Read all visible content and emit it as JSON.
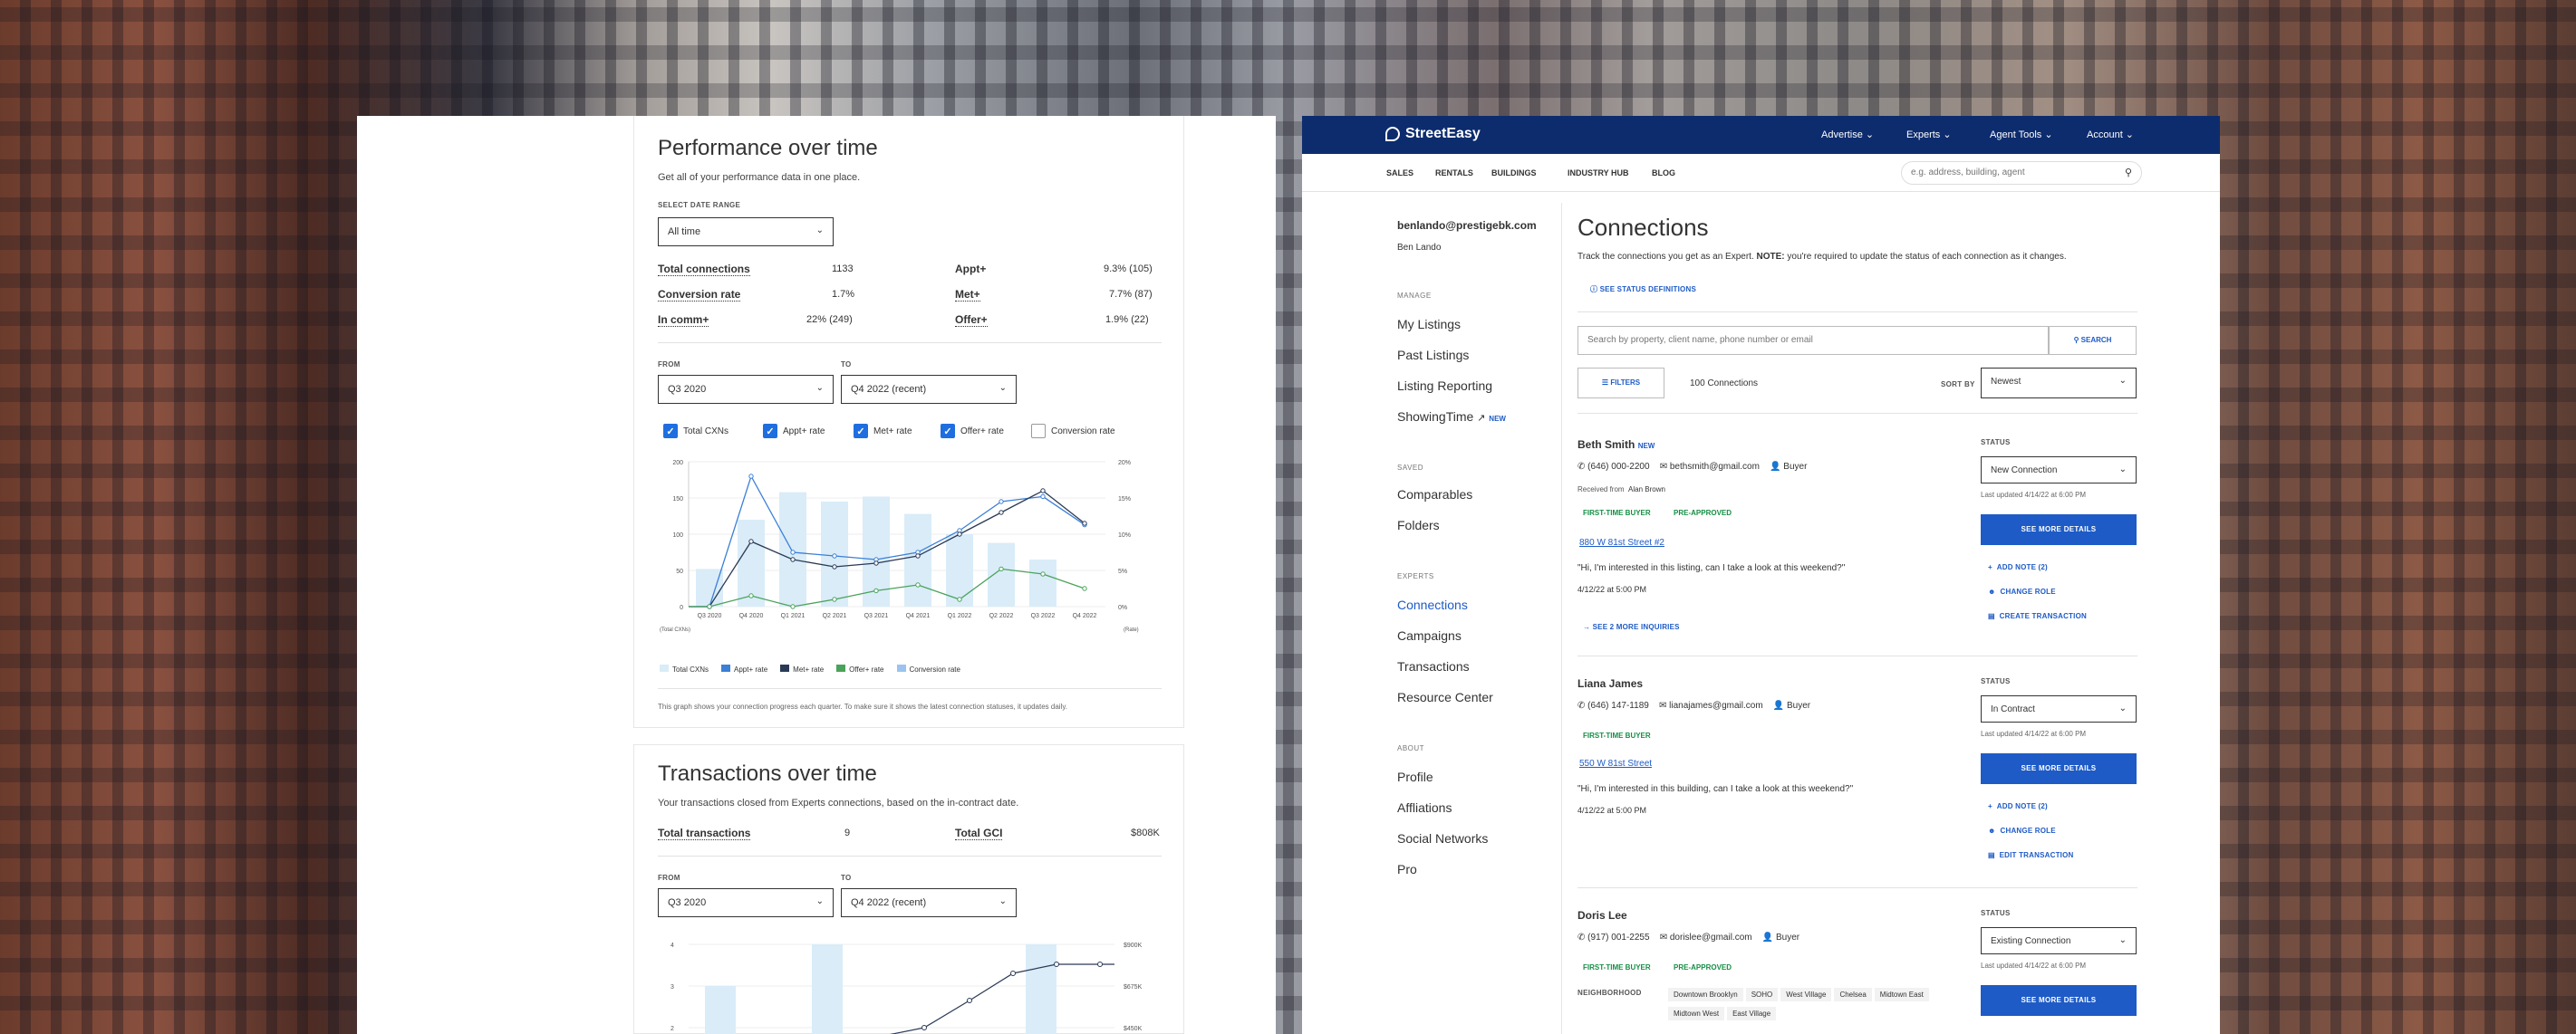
{
  "perf": {
    "title": "Performance over time",
    "subtitle": "Get all of your performance data in one place.",
    "date_range_label": "SELECT DATE RANGE",
    "date_range_value": "All time",
    "stats": [
      {
        "k": "Total connections",
        "v": "1133"
      },
      {
        "k": "Conversion rate",
        "v": "1.7%"
      },
      {
        "k": "In comm+",
        "v": "22% (249)"
      },
      {
        "k": "Appt+",
        "v": "9.3% (105)"
      },
      {
        "k": "Met+",
        "v": "7.7% (87)"
      },
      {
        "k": "Offer+",
        "v": "1.9% (22)"
      }
    ],
    "from_label": "FROM",
    "to_label": "TO",
    "from_value": "Q3 2020",
    "to_value": "Q4 2022 (recent)",
    "checks": [
      {
        "label": "Total CXNs",
        "on": true
      },
      {
        "label": "Appt+ rate",
        "on": true
      },
      {
        "label": "Met+ rate",
        "on": true
      },
      {
        "label": "Offer+ rate",
        "on": true
      },
      {
        "label": "Conversion rate",
        "on": false
      }
    ],
    "axis_left_unit": "(Total CXNs)",
    "axis_right_unit": "(Rate)",
    "footnote": "This graph shows your connection progress each quarter. To make sure it shows the latest connection statuses, it updates daily."
  },
  "trans": {
    "title": "Transactions over time",
    "subtitle": "Your transactions closed from Experts connections, based on the in-contract date.",
    "stat1_k": "Total transactions",
    "stat1_v": "9",
    "stat2_k": "Total GCI",
    "stat2_v": "$808K",
    "from_value": "Q3 2020",
    "to_value": "Q4 2022 (recent)",
    "y_ticks": [
      "4",
      "3",
      "2"
    ],
    "y2_ticks": [
      "$900K",
      "$675K",
      "$450K"
    ]
  },
  "chart_data": [
    {
      "type": "bar",
      "categories": [
        "Q3 2020",
        "Q4 2020",
        "Q1 2021",
        "Q2 2021",
        "Q3 2021",
        "Q4 2021",
        "Q1 2022",
        "Q2 2022",
        "Q3 2022",
        "Q4 2022"
      ],
      "ylim": [
        0,
        200
      ],
      "y2lim": [
        0,
        20
      ],
      "y_ticks": [
        "200",
        "150",
        "100",
        "50",
        "0"
      ],
      "y2_ticks": [
        "20%",
        "15%",
        "10%",
        "5%",
        "0%"
      ],
      "series": [
        {
          "name": "Total CXNs",
          "kind": "bar",
          "color": "#d9ecf8",
          "values": [
            52,
            120,
            158,
            145,
            152,
            128,
            100,
            88,
            65,
            0
          ]
        },
        {
          "name": "Appt+ rate",
          "kind": "line",
          "color": "#3b7fd6",
          "values": [
            0,
            18,
            7.5,
            7,
            6.5,
            7.5,
            10.5,
            14.5,
            15.2,
            11.3
          ]
        },
        {
          "name": "Met+ rate",
          "kind": "line",
          "color": "#2a3a55",
          "values": [
            0,
            9,
            6.5,
            5.5,
            6,
            7,
            10,
            13,
            16,
            11.5
          ]
        },
        {
          "name": "Offer+ rate",
          "kind": "line",
          "color": "#4aa35a",
          "values": [
            0,
            1.5,
            0,
            1,
            2.2,
            3,
            1,
            5.2,
            4.5,
            2.5
          ]
        }
      ],
      "legend": [
        "Total CXNs",
        "Appt+ rate",
        "Met+ rate",
        "Offer+ rate",
        "Conversion rate"
      ]
    }
  ],
  "se": {
    "brand": "StreetEasy",
    "nav": [
      "Advertise",
      "Experts",
      "Agent Tools",
      "Account"
    ],
    "subnav": [
      "SALES",
      "RENTALS",
      "BUILDINGS",
      "INDUSTRY HUB",
      "BLOG"
    ],
    "search_placeholder": "e.g. address, building, agent",
    "user_email": "benlando@prestigebk.com",
    "user_name": "Ben Lando",
    "side": [
      {
        "h": "MANAGE",
        "items": [
          "My Listings",
          "Past Listings",
          "Listing Reporting",
          "ShowingTime"
        ]
      },
      {
        "h": "SAVED",
        "items": [
          "Comparables",
          "Folders"
        ]
      },
      {
        "h": "EXPERTS",
        "items": [
          "Connections",
          "Campaigns",
          "Transactions",
          "Resource Center"
        ]
      },
      {
        "h": "ABOUT",
        "items": [
          "Profile",
          "Affliations",
          "Social Networks",
          "Pro"
        ]
      }
    ],
    "new_badge": "NEW",
    "conn_title": "Connections",
    "conn_desc_a": "Track the connections you get as an Expert. ",
    "conn_desc_note": "NOTE:",
    "conn_desc_b": " you're required to update the status of each connection as it changes.",
    "status_defs": "SEE STATUS DEFINITIONS",
    "search2_placeholder": "Search by property, client name, phone number or email",
    "search_btn": "SEARCH",
    "filters": "FILTERS",
    "count": "100 Connections",
    "sortby": "SORT BY",
    "sort_value": "Newest",
    "status_label": "STATUS",
    "see_more": "SEE MORE DETAILS",
    "c1": {
      "name": "Beth Smith",
      "new": "NEW",
      "phone": "(646) 000-2200",
      "email": "bethsmith@gmail.com",
      "role": "Buyer",
      "received": "Received from",
      "received_from": "Alan Brown",
      "tag1": "FIRST-TIME BUYER",
      "tag2": "PRE-APPROVED",
      "listing": "880 W 81st Street #2",
      "msg": "\"Hi, I'm interested in this listing, can I take a look at this weekend?\"",
      "time": "4/12/22 at 5:00 PM",
      "more": "SEE 2 MORE INQUIRIES",
      "status": "New Connection",
      "updated": "Last updated 4/14/22 at 6:00 PM",
      "a1": "ADD NOTE (2)",
      "a2": "CHANGE ROLE",
      "a3": "CREATE TRANSACTION"
    },
    "c2": {
      "name": "Liana James",
      "phone": "(646) 147-1189",
      "email": "lianajames@gmail.com",
      "role": "Buyer",
      "tag1": "FIRST-TIME BUYER",
      "listing": "550 W 81st Street",
      "msg": "\"Hi, I'm interested in this building, can I take a look at this weekend?\"",
      "time": "4/12/22 at 5:00 PM",
      "status": "In Contract",
      "updated": "Last updated 4/14/22 at 6:00 PM",
      "a1": "ADD NOTE (2)",
      "a2": "CHANGE ROLE",
      "a3": "EDIT TRANSACTION"
    },
    "c3": {
      "name": "Doris Lee",
      "phone": "(917) 001-2255",
      "email": "dorislee@gmail.com",
      "role": "Buyer",
      "tag1": "FIRST-TIME BUYER",
      "tag2": "PRE-APPROVED",
      "nbhd_label": "NEIGHBORHOOD",
      "chips": [
        "Downtown Brooklyn",
        "SOHO",
        "West Village",
        "Chelsea",
        "Midtown East",
        "Midtown West",
        "East Village"
      ],
      "status": "Existing Connection",
      "updated": "Last updated 4/14/22 at 6:00 PM"
    }
  }
}
